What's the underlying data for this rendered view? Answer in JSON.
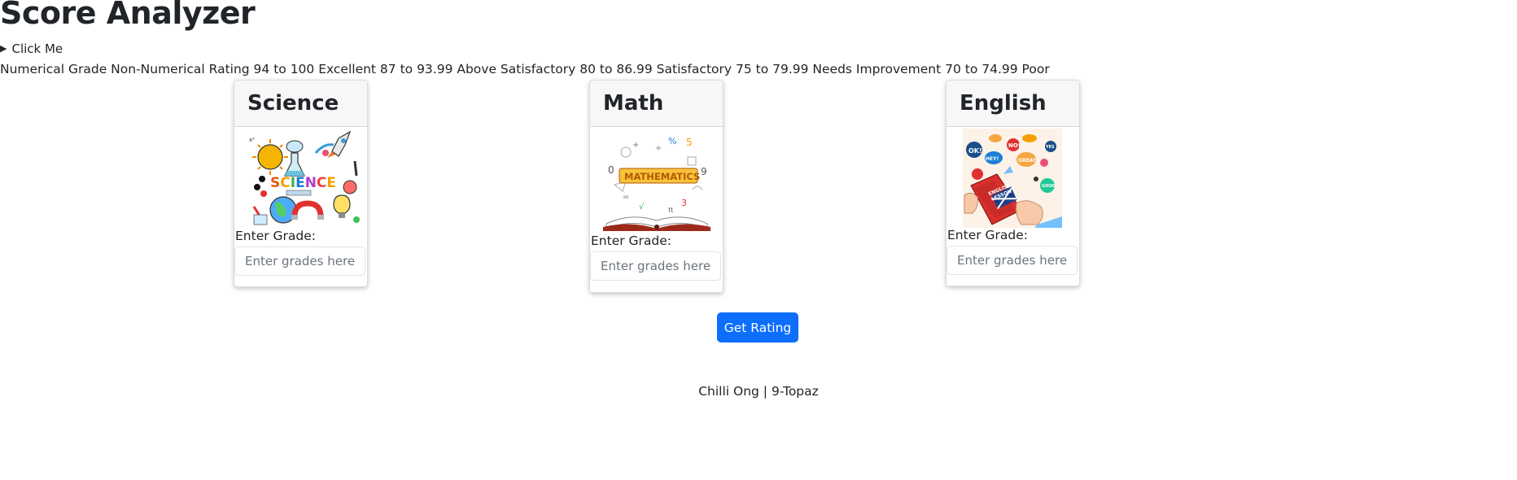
{
  "page": {
    "title": "Score Analyzer",
    "details_toggle": "Click Me",
    "grading_scale_text": "Numerical Grade Non-Numerical Rating 94 to 100 Excellent 87 to 93.99 Above Satisfactory 80 to 86.99 Satisfactory 75 to 79.99 Needs Improvement 70 to 74.99 Poor"
  },
  "subjects": [
    {
      "name": "Science",
      "label": "Enter Grade:",
      "placeholder": "Enter grades here",
      "image_icon": "science-doodle-icon"
    },
    {
      "name": "Math",
      "label": "Enter Grade:",
      "placeholder": "Enter grades here",
      "image_icon": "mathematics-book-icon"
    },
    {
      "name": "English",
      "label": "Enter Grade:",
      "placeholder": "Enter grades here",
      "image_icon": "english-lesson-book-icon"
    }
  ],
  "actions": {
    "get_rating_label": "Get Rating"
  },
  "footer": {
    "text": "Chilli Ong | 9-Topaz"
  },
  "colors": {
    "button_primary": "#0d6efd",
    "card_header_bg": "#f7f7f7",
    "text": "#212529"
  }
}
